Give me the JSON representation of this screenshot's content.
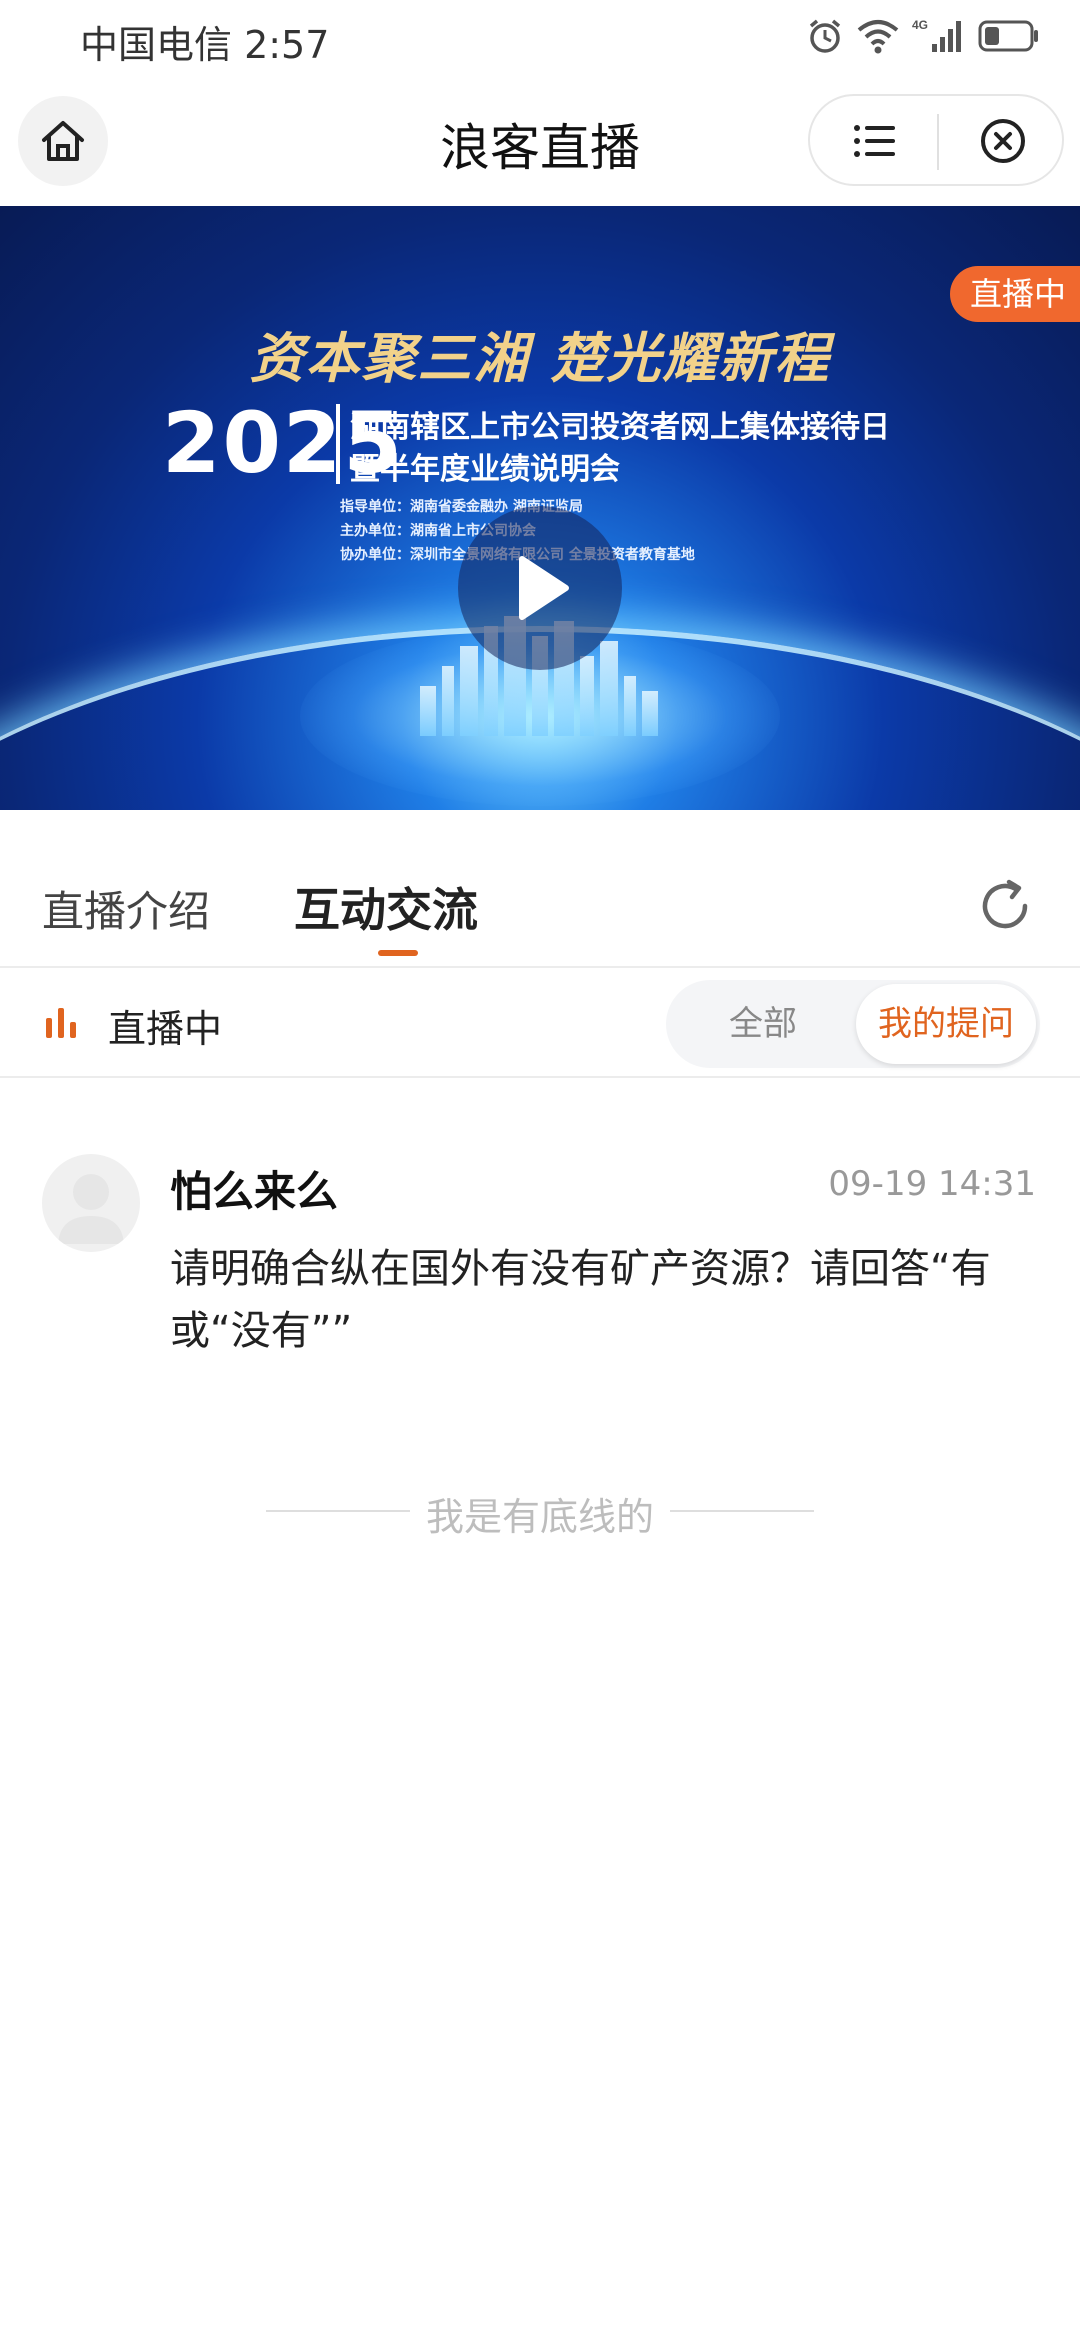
{
  "status_bar": {
    "carrier_time": "中国电信 2:57",
    "icons": [
      "alarm-icon",
      "wifi-icon",
      "4g-signal-icon",
      "battery-icon"
    ],
    "network_label": "4G"
  },
  "header": {
    "title": "浪客直播",
    "home_icon": "home-icon",
    "menu_icon": "menu-icon",
    "close_icon": "close-circle-icon"
  },
  "banner": {
    "slogan": "资本聚三湘 楚光耀新程",
    "year": "2025",
    "headline_line1": "湖南辖区上市公司投资者网上集体接待日",
    "headline_line2": "暨半年度业绩说明会",
    "org_guide": "指导单位：湖南省委金融办 湖南证监局",
    "org_host": "主办单位：湖南省上市公司协会",
    "org_co": "协办单位：深圳市全景网络有限公司 全景投资者教育基地",
    "live_badge": "直播中",
    "play_icon": "play-icon"
  },
  "tabs": {
    "intro": "直播介绍",
    "interact": "互动交流",
    "active": "interact",
    "refresh_icon": "refresh-icon"
  },
  "filter": {
    "status_text": "直播中",
    "status_icon": "live-bars-icon",
    "options": [
      "全部",
      "我的提问"
    ],
    "all": "全部",
    "mine": "我的提问",
    "selected": "我的提问"
  },
  "comments": [
    {
      "username": "怕么来么",
      "time": "09-19 14:31",
      "text": "请明确合纵在国外有没有矿产资源？请回答“有或“没有””"
    }
  ],
  "footer": {
    "bottom_text": "我是有底线的"
  },
  "colors": {
    "accent": "#e0641f",
    "badge": "#f0682e",
    "banner_deep": "#0a2777",
    "banner_light": "#6fd0ff",
    "gold": "#f2d28a"
  }
}
